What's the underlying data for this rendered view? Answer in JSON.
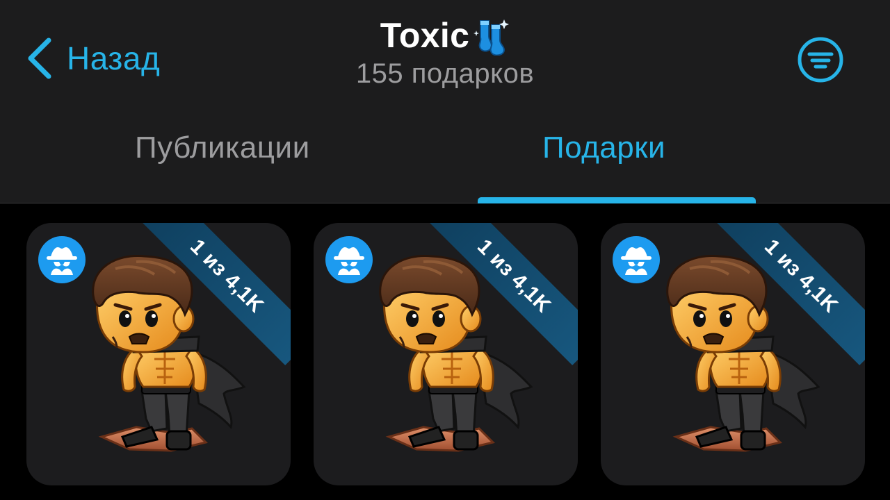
{
  "header": {
    "back_label": "Назад",
    "title": "Toxic",
    "title_emoji_icon": "blue-socks-emoji",
    "subtitle": "155 подарков",
    "filter_icon": "filter-icon"
  },
  "tabs": [
    {
      "label": "Публикации",
      "active": false
    },
    {
      "label": "Подарки",
      "active": true
    }
  ],
  "gifts": [
    {
      "ribbon": "1 из 4,1K",
      "badge_icon": "spy-incognito-icon",
      "image": "muscular-caped-hero-figure"
    },
    {
      "ribbon": "1 из 4,1K",
      "badge_icon": "spy-incognito-icon",
      "image": "muscular-caped-hero-figure"
    },
    {
      "ribbon": "1 из 4,1K",
      "badge_icon": "spy-incognito-icon",
      "image": "muscular-caped-hero-figure"
    }
  ],
  "colors": {
    "accent": "#27b4e8",
    "header_bg": "#1c1c1d",
    "page_bg": "#000000",
    "card_bg": "#1c1c1e",
    "ribbon_bg": "#124a6e",
    "secondary_text": "#9d9d9f"
  }
}
